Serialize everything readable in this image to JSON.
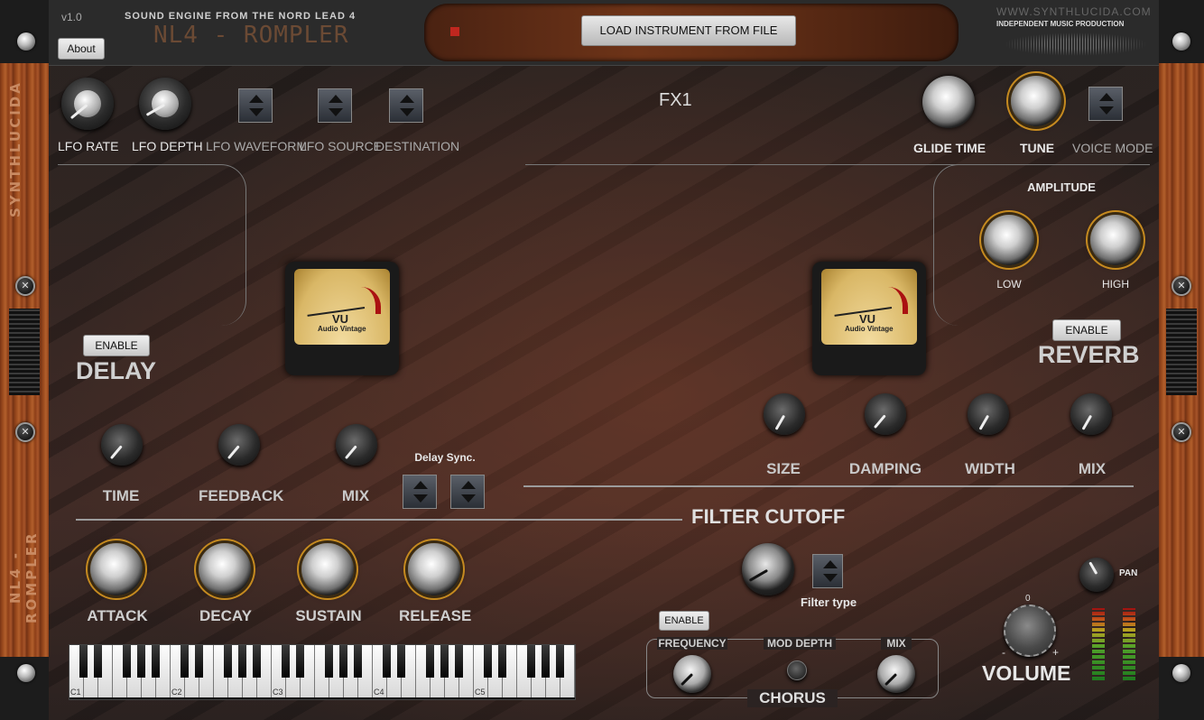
{
  "header": {
    "version": "v1.0",
    "about_label": "About",
    "subtitle": "SOUND ENGINE FROM THE NORD LEAD 4",
    "product_name": "NL4 - ROMPLER",
    "load_button_label": "LOAD INSTRUMENT FROM FILE",
    "brand_url": "WWW.SYNTHLUCIDA.COM",
    "brand_tagline": "INDEPENDENT MUSIC PRODUCTION"
  },
  "side": {
    "left_top_text": "SYNTHLUCIDA",
    "left_bottom_text": "NL4 - ROMPLER"
  },
  "lfo": {
    "rate_label": "LFO RATE",
    "depth_label": "LFO DEPTH",
    "waveform_label": "LFO WAVEFORM",
    "source_label": "LFO SOURCE",
    "destination_label": "DESTINATION"
  },
  "fx": {
    "title": "FX1"
  },
  "voice": {
    "glide_label": "GLIDE TIME",
    "tune_label": "TUNE",
    "voice_mode_label": "VOICE MODE"
  },
  "amplitude": {
    "title": "AMPLITUDE",
    "low_label": "LOW",
    "high_label": "HIGH"
  },
  "vu_meter": {
    "label": "VU",
    "brand": "Audio Vintage",
    "scale": [
      "20",
      "10",
      "7",
      "5",
      "3",
      "2",
      "1",
      "0",
      "1",
      "2",
      "3"
    ]
  },
  "delay": {
    "enable_label": "ENABLE",
    "title": "DELAY",
    "time_label": "TIME",
    "feedback_label": "FEEDBACK",
    "mix_label": "MIX",
    "sync_label": "Delay Sync."
  },
  "reverb": {
    "enable_label": "ENABLE",
    "title": "REVERB",
    "size_label": "SIZE",
    "damping_label": "DAMPING",
    "width_label": "WIDTH",
    "mix_label": "MIX"
  },
  "envelope": {
    "attack_label": "ATTACK",
    "decay_label": "DECAY",
    "sustain_label": "SUSTAIN",
    "release_label": "RELEASE"
  },
  "filter": {
    "title": "FILTER CUTOFF",
    "type_label": "Filter type"
  },
  "chorus": {
    "enable_label": "ENABLE",
    "frequency_label": "FREQUENCY",
    "mod_depth_label": "MOD DEPTH",
    "mix_label": "MIX",
    "title": "CHORUS"
  },
  "output": {
    "volume_label": "VOLUME",
    "pan_label": "PAN",
    "volume_zero": "0",
    "volume_minus": "-",
    "volume_plus": "+"
  },
  "keyboard": {
    "octave_labels": [
      "C1",
      "C2",
      "C3",
      "C4",
      "C5"
    ]
  },
  "colors": {
    "accent_amber": "#c58a20",
    "wood": "#9a4a1e",
    "vu_red": "#aa1111"
  }
}
